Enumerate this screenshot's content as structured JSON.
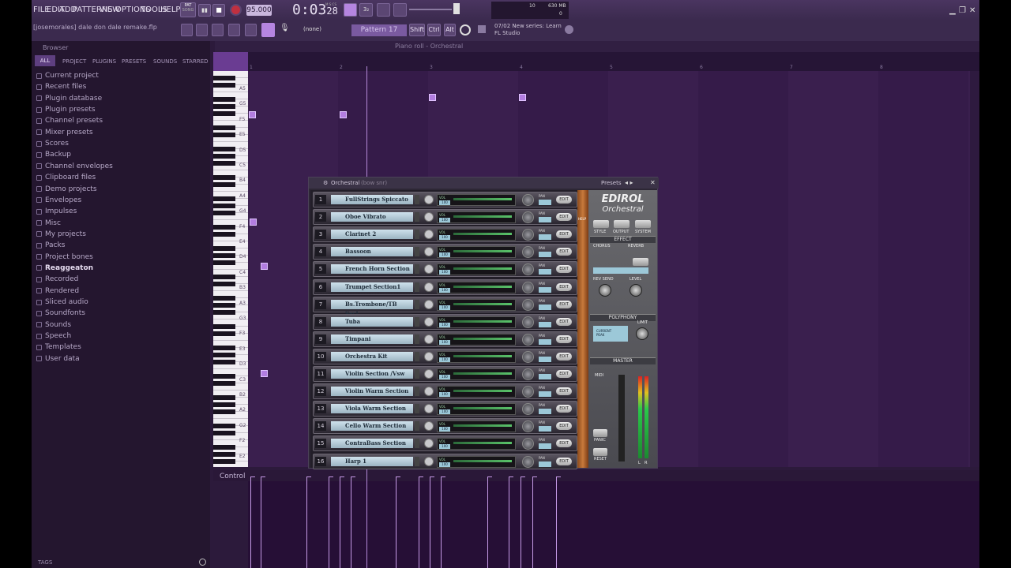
{
  "menu": [
    "FILE",
    "EDIT",
    "ADD",
    "PATTERNS",
    "VIEW",
    "OPTIONS",
    "TOOLS",
    "HELP"
  ],
  "transport": {
    "pat_label": "PAT",
    "song_label": "SONG",
    "tempo": "95.000",
    "time": "0:03",
    "time_small": "28",
    "mscs": "M:S:CS"
  },
  "cpu": {
    "cpu_value": "10",
    "mem_value": "630 MB",
    "voices": "0"
  },
  "toolbar2": {
    "filename": "[josemorales] dale don dale remake.flp",
    "none_label": "(none)",
    "pattern": "Pattern 17",
    "shift": "Shift",
    "ctrl": "Ctrl",
    "alt": "Alt"
  },
  "news": {
    "date": "07/02",
    "line1": "New series: Learn",
    "line2": "FL Studio"
  },
  "browser": {
    "title": "Browser",
    "tabs": [
      "ALL",
      "PROJECT",
      "PLUGINS",
      "PRESETS",
      "SOUNDS",
      "STARRED"
    ],
    "items": [
      {
        "label": "Current project",
        "bold": false
      },
      {
        "label": "Recent files",
        "bold": false
      },
      {
        "label": "Plugin database",
        "bold": false
      },
      {
        "label": "Plugin presets",
        "bold": false
      },
      {
        "label": "Channel presets",
        "bold": false
      },
      {
        "label": "Mixer presets",
        "bold": false
      },
      {
        "label": "Scores",
        "bold": false
      },
      {
        "label": "Backup",
        "bold": false
      },
      {
        "label": "Channel envelopes",
        "bold": false
      },
      {
        "label": "Clipboard files",
        "bold": false
      },
      {
        "label": "Demo projects",
        "bold": false
      },
      {
        "label": "Envelopes",
        "bold": false
      },
      {
        "label": "Impulses",
        "bold": false
      },
      {
        "label": "Misc",
        "bold": false
      },
      {
        "label": "My projects",
        "bold": false
      },
      {
        "label": "Packs",
        "bold": false
      },
      {
        "label": "Project bones",
        "bold": false
      },
      {
        "label": "Reaggeaton",
        "bold": true
      },
      {
        "label": "Recorded",
        "bold": false
      },
      {
        "label": "Rendered",
        "bold": false
      },
      {
        "label": "Sliced audio",
        "bold": false
      },
      {
        "label": "Soundfonts",
        "bold": false
      },
      {
        "label": "Sounds",
        "bold": false
      },
      {
        "label": "Speech",
        "bold": false
      },
      {
        "label": "Templates",
        "bold": false
      },
      {
        "label": "User data",
        "bold": false
      }
    ],
    "tags_label": "TAGS"
  },
  "piano_roll": {
    "title": "Piano roll - Orchestral",
    "bar_numbers": [
      "1",
      "2",
      "3",
      "4",
      "5",
      "6",
      "7",
      "8"
    ],
    "key_labels": [
      "A5",
      "G5",
      "F5",
      "E5",
      "D5",
      "C5",
      "B4",
      "A4",
      "G4",
      "F4",
      "E4",
      "D4",
      "C4",
      "B3",
      "A3",
      "G3",
      "F3",
      "E3",
      "D3",
      "C3",
      "B2",
      "A2",
      "G2",
      "F2",
      "E2"
    ],
    "control_label": "Control"
  },
  "plugin": {
    "title": "Orchestral",
    "subtitle": "(bow snr)",
    "presets_label": "Presets",
    "brand": "EDIROL",
    "product": "Orchestral",
    "vol_label": "VOL",
    "vol_value": "100",
    "pan_label": "PAN",
    "edit_label": "EDIT",
    "channels": [
      {
        "num": "1",
        "name": "FullStrings Spiccato"
      },
      {
        "num": "2",
        "name": "Oboe Vibrato"
      },
      {
        "num": "3",
        "name": "Clarinet 2"
      },
      {
        "num": "4",
        "name": "Bassoon"
      },
      {
        "num": "5",
        "name": "French Horn Section"
      },
      {
        "num": "6",
        "name": "Trumpet Section1"
      },
      {
        "num": "7",
        "name": "Bs.Trombone/TB Sect."
      },
      {
        "num": "8",
        "name": "Tuba"
      },
      {
        "num": "9",
        "name": "Timpani"
      },
      {
        "num": "10",
        "name": "Orchestra Kit"
      },
      {
        "num": "11",
        "name": "Violin Section /Vsw"
      },
      {
        "num": "12",
        "name": "Violin Warm Section"
      },
      {
        "num": "13",
        "name": "Viola Warm Section"
      },
      {
        "num": "14",
        "name": "Cello Warm Section"
      },
      {
        "num": "15",
        "name": "ContraBass Section"
      },
      {
        "num": "16",
        "name": "Harp 1"
      }
    ],
    "side": {
      "style": "STYLE",
      "output": "OUTPUT",
      "system": "SYSTEM",
      "effect": "EFFECT",
      "chorus": "CHORUS",
      "reverb": "REVERB",
      "rev_send": "REV SEND",
      "level": "LEVEL",
      "polyphony": "POLYPHONY",
      "limit": "LIMIT",
      "current": "CURRENT",
      "peak": "PEAK",
      "master": "MASTER",
      "midi": "MIDI",
      "panic": "PANIC",
      "reset": "RESET",
      "l": "L",
      "r": "R",
      "help": "HELP"
    }
  },
  "colors": {
    "accent": "#b27de0",
    "background": "#2c1a3b",
    "plugin_label": "#cfe2ec"
  }
}
